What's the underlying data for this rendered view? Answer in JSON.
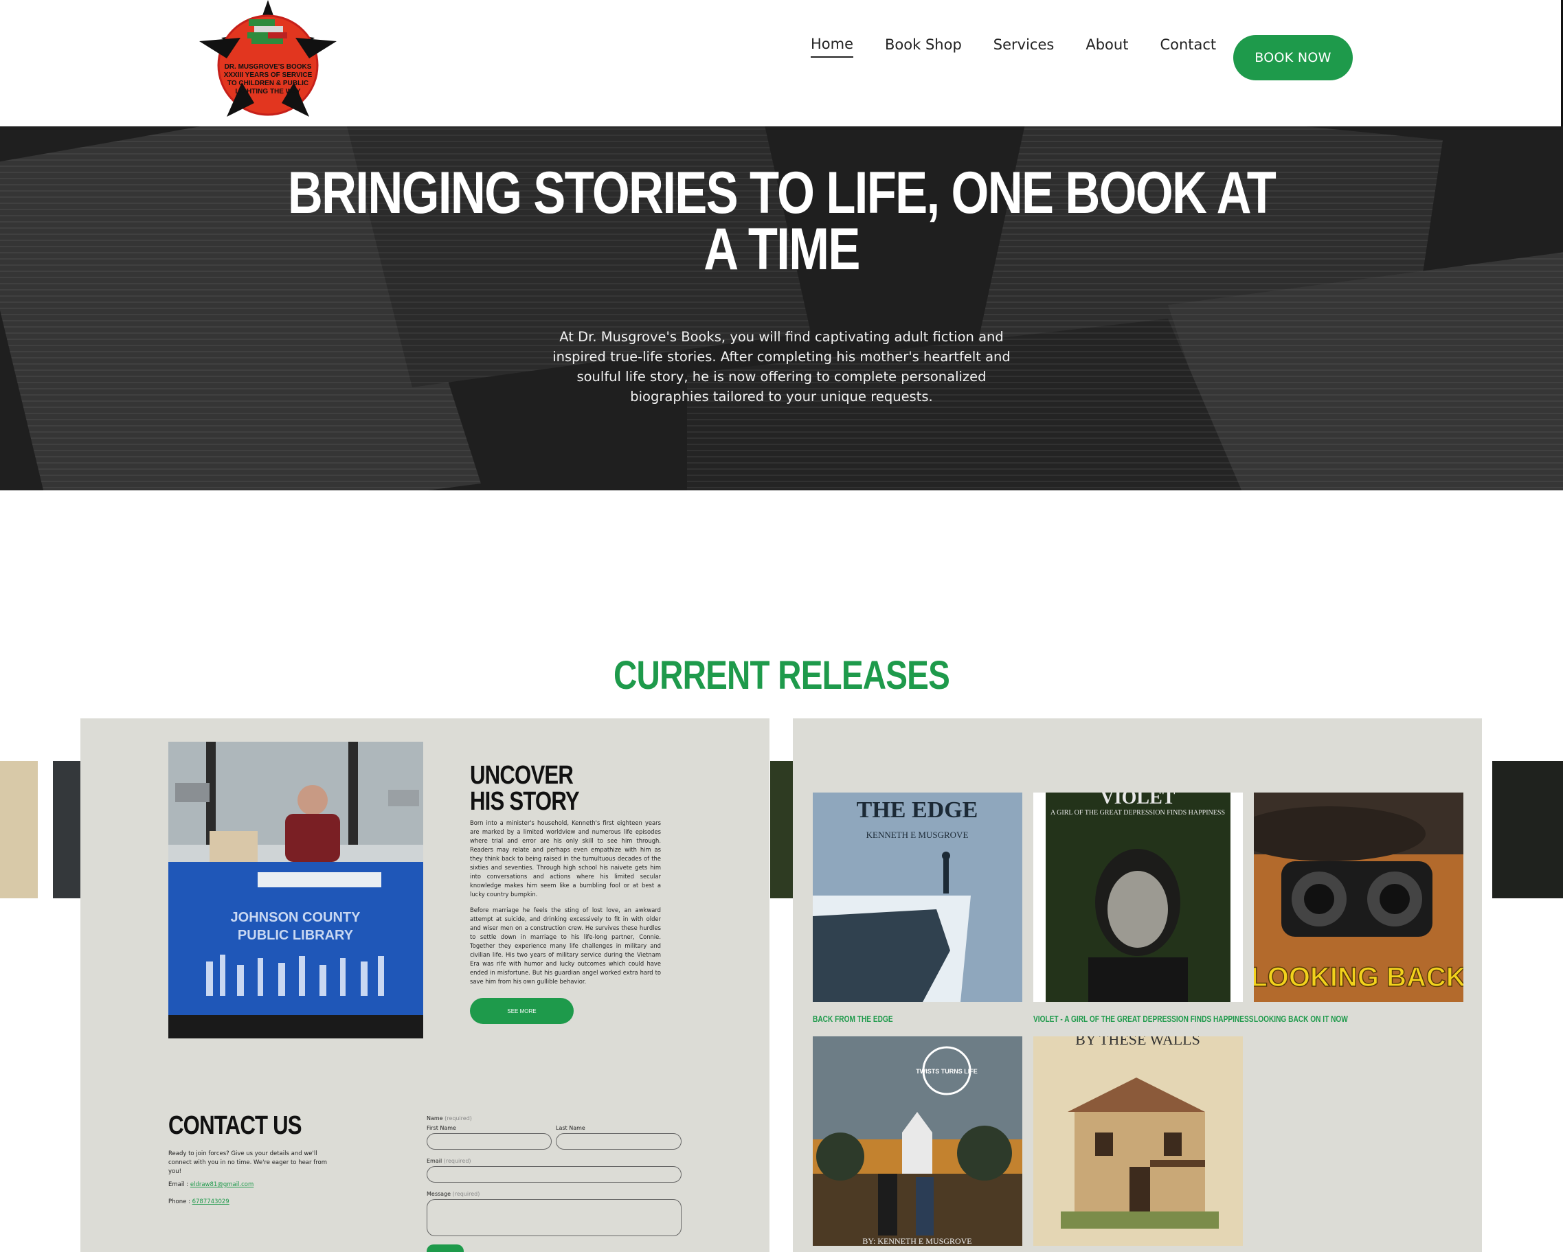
{
  "brand": {
    "logo_text": [
      "DR. MUSGROVE'S BOOKS",
      "XXXIII YEARS OF SERVICE",
      "TO CHILDREN & PUBLIC",
      "LIGHTING THE WAY"
    ],
    "colors": {
      "accent_green": "#1e9a4b",
      "logo_red": "#e2361f"
    }
  },
  "nav": {
    "items": [
      {
        "label": "Home",
        "active": true
      },
      {
        "label": "Book Shop",
        "active": false
      },
      {
        "label": "Services",
        "active": false
      },
      {
        "label": "About",
        "active": false
      },
      {
        "label": "Contact",
        "active": false
      }
    ],
    "cta_label": "BOOK NOW"
  },
  "hero": {
    "title_line1": "BRINGING STORIES TO LIFE, ONE BOOK AT",
    "title_line2": "A TIME",
    "text": "At Dr. Musgrove's Books, you will find captivating adult fiction and inspired true-life stories. After completing his mother's heartfelt and soulful life story, he is now offering to complete personalized biographies tailored to your unique requests."
  },
  "releases": {
    "title": "CURRENT RELEASES",
    "story": {
      "title": "UNCOVER\nHIS STORY",
      "photo_banner_line1": "JOHNSON COUNTY",
      "photo_banner_line2": "PUBLIC LIBRARY",
      "paragraph1": "Born into a minister's household, Kenneth's first eighteen years are marked by a limited worldview and numerous life episodes where trial and error are his only skill to see him through. Readers may relate and perhaps even empathize with him as they think back to being raised in the tumultuous decades of the sixties and seventies. Through high school his naivete gets him into conversations and actions where his limited secular knowledge makes him seem like a bumbling fool or at best a lucky country bumpkin.",
      "paragraph2": "Before marriage he feels the sting of lost love, an awkward attempt at suicide, and drinking excessively to fit in with older and wiser men on a construction crew. He survives these hurdles to settle down in marriage to his life-long partner, Connie. Together they experience many life challenges in military and civilian life. His two years of military service during the Vietnam Era was rife with humor and lucky outcomes which could have ended in misfortune. But his guardian angel worked extra hard to save him from his own gullible behavior.",
      "button_label": "SEE MORE"
    },
    "contact": {
      "title": "CONTACT US",
      "text": "Ready to join forces? Give us your details and we'll connect with you in no time. We're eager to hear from you!",
      "email_label": "Email : ",
      "email_value": "eldraw81@gmail.com",
      "phone_label": "Phone : ",
      "phone_value": "6787743029",
      "form": {
        "name_label": "Name",
        "required": "(required)",
        "first_name_label": "First Name",
        "last_name_label": "Last Name",
        "email_label": "Email",
        "message_label": "Message"
      }
    },
    "books": [
      {
        "caption": "BACK FROM THE EDGE",
        "cover_title": "THE EDGE",
        "cover_author": "KENNETH E MUSGROVE"
      },
      {
        "caption": "VIOLET - A GIRL OF THE GREAT DEPRESSION FINDS HAPPINESS",
        "cover_title": "VIOLET",
        "cover_subtitle": "A GIRL OF THE GREAT DEPRESSION FINDS HAPPINESS"
      },
      {
        "caption": "LOOKING BACK ON IT NOW",
        "cover_title": "LOOKING BACK"
      },
      {
        "caption": "",
        "cover_title": "TWISTS TURNS LIFE",
        "cover_author": "BY: KENNETH E MUSGROVE"
      },
      {
        "caption": "",
        "cover_title": "BY THESE WALLS"
      }
    ]
  }
}
